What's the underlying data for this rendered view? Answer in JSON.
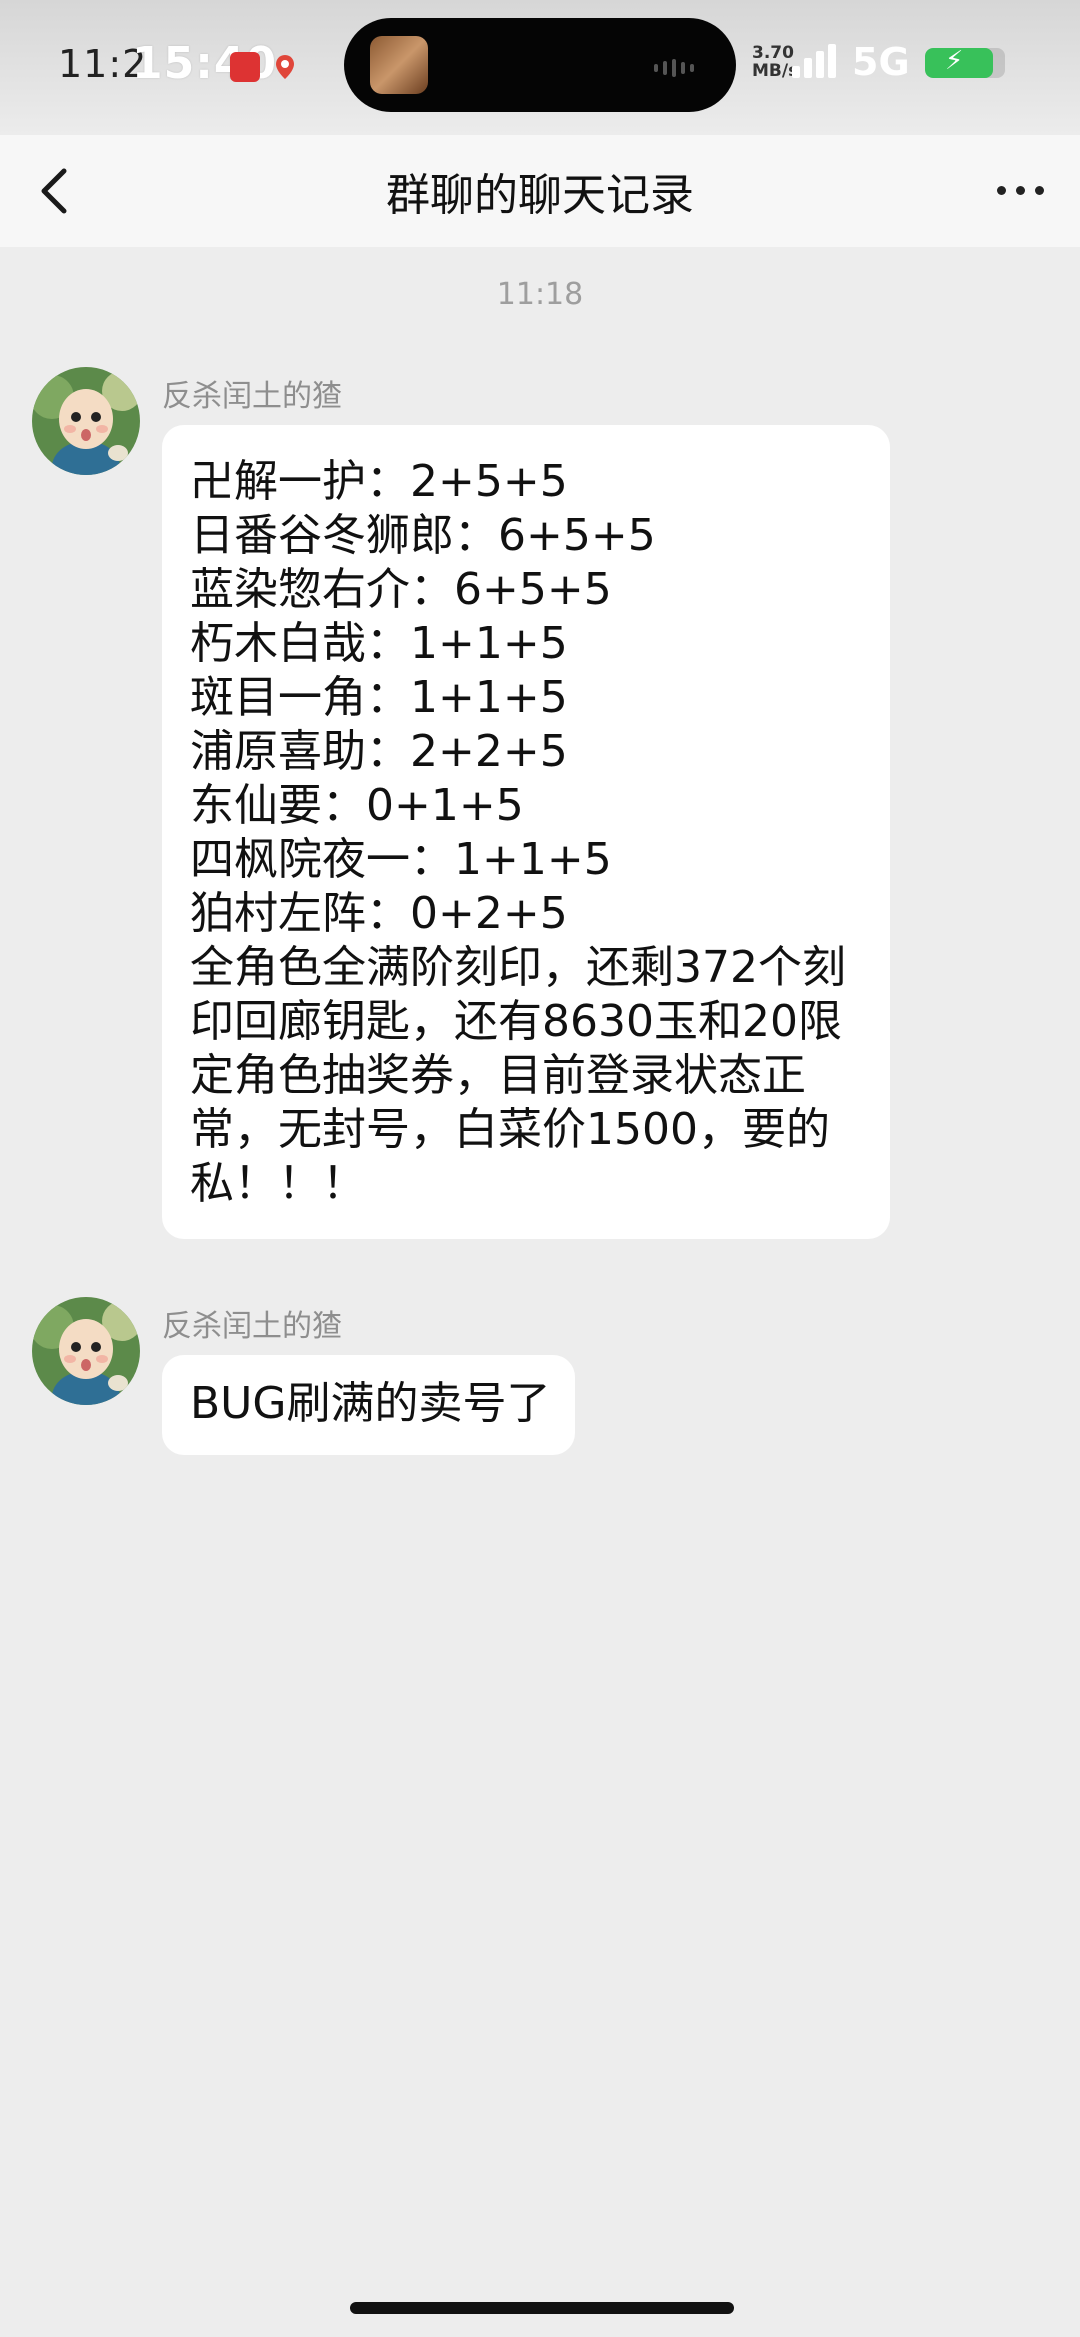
{
  "status_bar": {
    "time_under": "11:2",
    "time": "15:40",
    "network_speed_value": "3.70",
    "network_speed_unit": "MB/s",
    "network_type": "5G",
    "battery_level": 0.85,
    "battery_color": "#38c15a"
  },
  "nav": {
    "back_icon": "chevron-left-icon",
    "title": "群聊的聊天记录",
    "more_icon": "ellipsis-icon"
  },
  "chat": {
    "timestamp": "11:18",
    "messages": [
      {
        "sender": "反杀闰土的猹",
        "avatar": "cartoon-child-avatar",
        "text": "卍解一护：2+5+5\n日番谷冬狮郎：6+5+5\n蓝染惣右介：6+5+5\n朽木白哉：1+1+5\n斑目一角：1+1+5\n浦原喜助：2+2+5\n东仙要：0+1+5\n四枫院夜一：1+1+5\n狛村左阵：0+2+5\n全角色全满阶刻印，还剩372个刻印回廊钥匙，还有8630玉和20限定角色抽奖券，目前登录状态正常，无封号，白菜价1500，要的私！！！"
      },
      {
        "sender": "反杀闰土的猹",
        "avatar": "cartoon-child-avatar",
        "text": "BUG刷满的卖号了"
      }
    ]
  },
  "colors": {
    "background": "#EDEDED",
    "bubble": "#FFFFFF",
    "nav_background": "#F7F7F7",
    "secondary_text": "#8E8E8E"
  }
}
